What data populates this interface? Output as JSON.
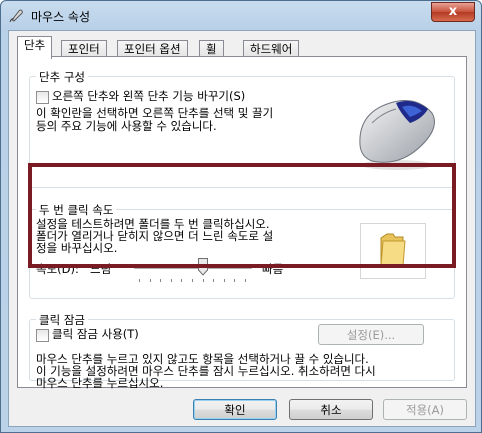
{
  "window": {
    "title": "마우스 속성",
    "close_glyph": "x"
  },
  "tabs": [
    {
      "label": "단추",
      "active": true
    },
    {
      "label": "포인터",
      "active": false
    },
    {
      "label": "포인터 옵션",
      "active": false
    },
    {
      "label": "휠",
      "active": false
    },
    {
      "label": "하드웨어",
      "active": false
    }
  ],
  "button_config": {
    "legend": "단추 구성",
    "checkbox_label": "오른쪽 단추와 왼쪽 단추 기능 바꾸기(S)",
    "checked": false,
    "desc_line1": "이 확인란을 선택하면 오른쪽 단추를 선택 및 끌기",
    "desc_line2": "등의 주요 기능에 사용할 수 있습니다."
  },
  "double_click": {
    "legend": "두 번 클릭 속도",
    "desc_line1": "설정을 테스트하려면 폴더를 두 번 클릭하십시오.",
    "desc_line2": "폴더가 열리거나 닫히지 않으면 더 느린 속도로 설",
    "desc_line3": "정을 바꾸십시오.",
    "speed_label": "속도(D):",
    "slow_label": "느림",
    "fast_label": "빠름",
    "speed_value_fraction": 0.6
  },
  "click_lock": {
    "legend": "클릭 잠금",
    "checkbox_label": "클릭 잠금 사용(T)",
    "checked": false,
    "settings_button": "설정(E)...",
    "desc_line1": "마우스 단추를 누르고 있지 않고도 항목을 선택하거나 끌 수 있습니다.",
    "desc_line2": "이 기능을 설정하려면 마우스 단추를 잠시 누르십시오. 취소하려면 다시",
    "desc_line3": "마우스 단추를 누르십시오."
  },
  "footer": {
    "ok": "확인",
    "cancel": "취소",
    "apply": "적용(A)"
  },
  "colors": {
    "highlight_border": "#7a1a22",
    "title_bar": "#b8d0e8",
    "close_button": "#c7513b"
  }
}
